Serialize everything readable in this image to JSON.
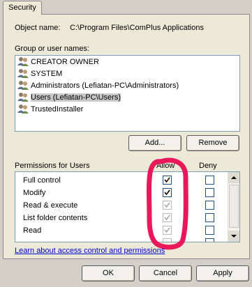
{
  "tabs": [
    {
      "label": "Security"
    }
  ],
  "object": {
    "label": "Object name:",
    "value": "C:\\Program Files\\ComPlus Applications"
  },
  "groups": {
    "label": "Group or user names:",
    "items": [
      {
        "label": "CREATOR OWNER"
      },
      {
        "label": "SYSTEM"
      },
      {
        "label": "Administrators (Lefiatan-PC\\Administrators)"
      },
      {
        "label": "Users (Lefiatan-PC\\Users)"
      },
      {
        "label": "TrustedInstaller"
      }
    ],
    "selected": "Users (Lefiatan-PC\\Users)"
  },
  "buttons": {
    "add": "Add...",
    "remove": "Remove"
  },
  "permissions": {
    "label": "Permissions for Users",
    "allow_header": "Allow",
    "deny_header": "Deny",
    "rows": [
      {
        "name": "Full control",
        "allow": "checked",
        "deny": "unchecked"
      },
      {
        "name": "Modify",
        "allow": "checked",
        "deny": "unchecked"
      },
      {
        "name": "Read & execute",
        "allow": "checked-disabled",
        "deny": "unchecked"
      },
      {
        "name": "List folder contents",
        "allow": "checked-disabled",
        "deny": "unchecked"
      },
      {
        "name": "Read",
        "allow": "checked-disabled",
        "deny": "unchecked"
      }
    ]
  },
  "link": "Learn about access control and permissions",
  "dialog_buttons": {
    "ok": "OK",
    "cancel": "Cancel",
    "apply": "Apply"
  },
  "colors": {
    "annotation": "#e8185a",
    "link": "#0000cc"
  },
  "icons": {
    "user": "users-group-icon",
    "check": "check-icon"
  }
}
